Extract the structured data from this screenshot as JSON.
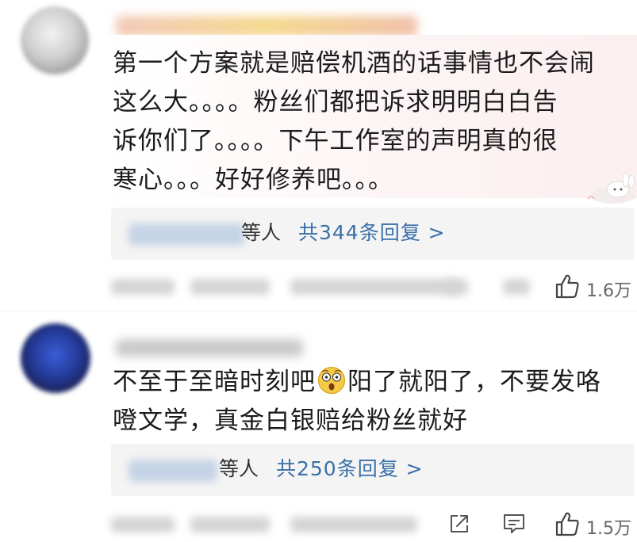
{
  "comments": [
    {
      "text": "第一个方案就是赔偿机酒的话事情也不会闹\n这么大。。。。粉丝们都把诉求明明白白告\n诉你们了。。。。下午工作室的声明真的很\n寒心。。。好好修养吧。。。",
      "reply_suffix": "等人",
      "reply_count": "共344条回复 >",
      "likes": "1.6万"
    },
    {
      "text_before_emoji": "不至于至暗时刻吧",
      "text_after_emoji": "阳了就阳了，不要发咯\n噔文学，真金白银赔给粉丝就好",
      "reply_suffix": "等人",
      "reply_count": "共250条回复 >",
      "likes": "1.5万"
    }
  ],
  "icons": {
    "like": "thumbs-up-icon",
    "share": "share-icon",
    "comment": "comment-icon",
    "emoji": "astonished-face-emoji",
    "sticker": "bunny-sticker"
  },
  "colors": {
    "link": "#3a6fa8",
    "reply_bg": "#f4f4f4",
    "bubble_pink": "#fbeff0"
  }
}
